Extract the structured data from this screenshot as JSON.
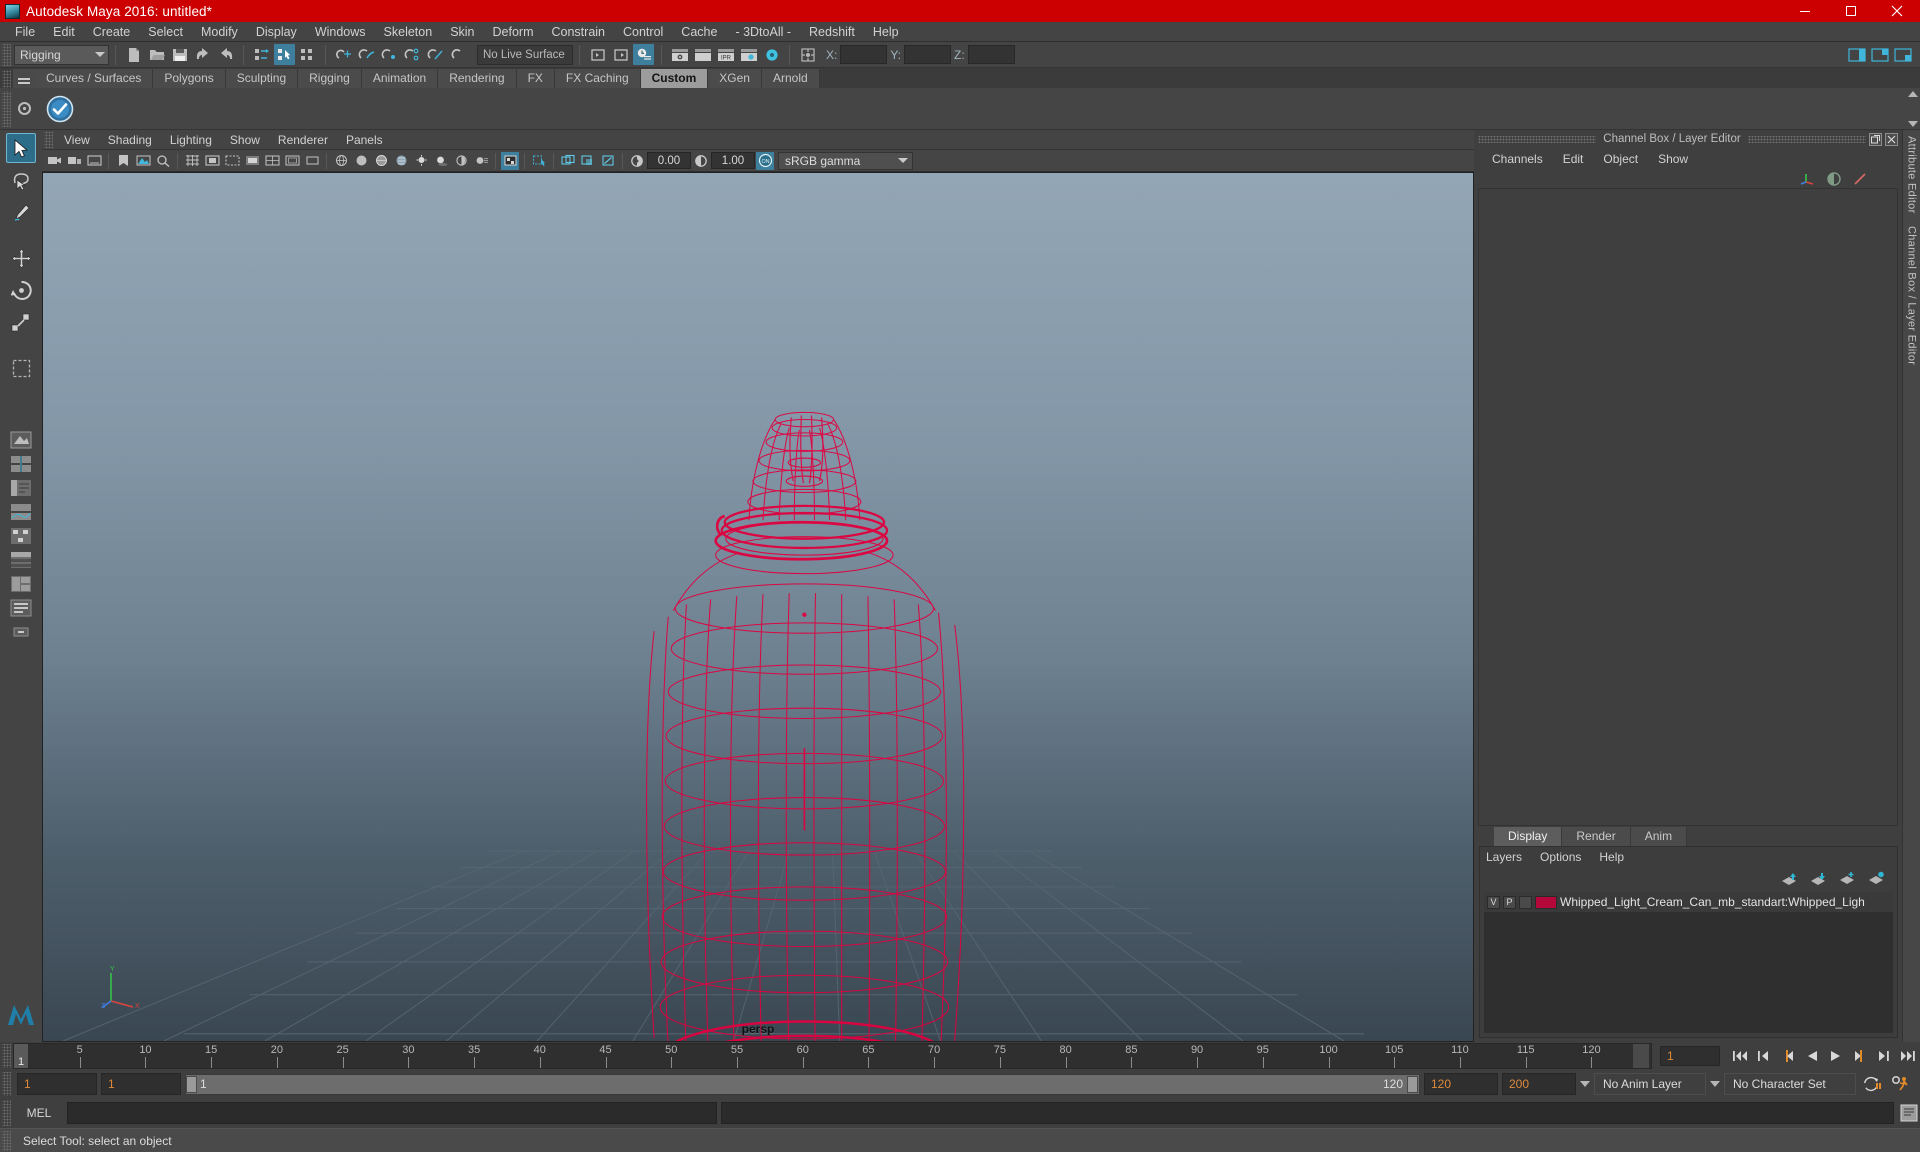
{
  "window": {
    "title": "Autodesk Maya 2016: untitled*",
    "icon": "maya-app-icon",
    "minimize": "minimize-icon",
    "maximize": "maximize-icon",
    "close": "close-icon",
    "titlebar_color": "#cc0000"
  },
  "menubar": {
    "items": [
      "File",
      "Edit",
      "Create",
      "Select",
      "Modify",
      "Display",
      "Windows",
      "Skeleton",
      "Skin",
      "Deform",
      "Constrain",
      "Control",
      "Cache",
      "- 3DtoAll -",
      "Redshift",
      "Help"
    ]
  },
  "statusline": {
    "menuset": "Rigging",
    "live_surface": "No Live Surface",
    "coords": {
      "x_label": "X:",
      "y_label": "Y:",
      "z_label": "Z:",
      "x_value": "",
      "y_value": "",
      "z_value": ""
    },
    "icons": [
      "new-scene-icon",
      "open-scene-icon",
      "save-scene-icon",
      "undo-icon",
      "redo-icon",
      "select-hierarchy-icon",
      "select-object-icon",
      "select-component-icon",
      "snap-grid-icon",
      "snap-curve-icon",
      "snap-point-icon",
      "snap-projected-icon",
      "snap-view-plane-icon",
      "make-live-icon",
      "open-editor-icon",
      "open-outliner-icon",
      "render-history-icon",
      "render-view-icon",
      "render-current-frame-icon",
      "ipr-render-icon",
      "render-settings-icon",
      "hypershade-icon",
      "show-manipulator-icon"
    ],
    "right_icons": [
      "sidebar-attribute-icon",
      "sidebar-tool-icon",
      "sidebar-channel-icon"
    ]
  },
  "shelf": {
    "tabs": [
      "Curves / Surfaces",
      "Polygons",
      "Sculpting",
      "Rigging",
      "Animation",
      "Rendering",
      "FX",
      "FX Caching",
      "Custom",
      "XGen",
      "Arnold"
    ],
    "active_tab": "Custom",
    "menu_icon": "shelf-hamburger-icon",
    "gear_icon": "shelf-gear-icon",
    "item_icon": "custom-shelf-button-icon"
  },
  "toolbox": {
    "tools": [
      {
        "name": "select-tool",
        "active": true
      },
      {
        "name": "lasso-select-tool",
        "active": false
      },
      {
        "name": "paint-select-tool",
        "active": false
      },
      {
        "name": "move-tool",
        "active": false
      },
      {
        "name": "rotate-tool",
        "active": false
      },
      {
        "name": "scale-tool",
        "active": false
      },
      {
        "name": "last-tool-used",
        "active": false
      }
    ],
    "layout_buttons": [
      "single-perspective-layout",
      "four-view-layout",
      "persp-outliner-layout",
      "persp-graph-layout",
      "persp-hypershade-layout",
      "two-pane-layout",
      "three-pane-layout",
      "outliner-layout"
    ],
    "logo": "maya-logo-icon"
  },
  "viewport": {
    "menus": [
      "View",
      "Shading",
      "Lighting",
      "Show",
      "Renderer",
      "Panels"
    ],
    "camera_label": "persp",
    "exposure_value": "0.00",
    "gamma_value": "1.00",
    "color_management": "sRGB gamma",
    "gate_toggle": "ON",
    "toolbar_icons": [
      "select-camera-icon",
      "lock-camera-icon",
      "camera-attributes-icon",
      "bookmark-icon",
      "image-plane-icon",
      "two-d-pan-zoom-icon",
      "grid-toggle-icon",
      "film-gate-icon",
      "resolution-gate-icon",
      "gate-mask-icon",
      "field-chart-icon",
      "safe-action-icon",
      "safe-title-icon",
      "wireframe-icon",
      "smooth-shade-icon",
      "shaded-wireframe-icon",
      "textured-icon",
      "lights-icon",
      "shadows-icon",
      "screen-space-ao-icon",
      "motion-blur-icon",
      "multisample-icon",
      "depth-of-field-icon",
      "isolate-select-icon",
      "xray-icon",
      "xray-joints-icon",
      "xray-active-components-icon",
      "exposure-icon",
      "gamma-icon",
      "color-management-toggle-icon"
    ],
    "object_color": "#d4003c",
    "background_top": "#93a6b6",
    "background_bottom": "#3a4752"
  },
  "channelbox": {
    "panel_title": "Channel Box / Layer Editor",
    "undock_icon": "undock-icon",
    "close_icon": "close-panel-icon",
    "menus": [
      "Channels",
      "Edit",
      "Object",
      "Show"
    ],
    "header_icons": [
      "manipulator-icon",
      "half-circle-icon",
      "speed-icon"
    ],
    "attribute_editor_label": "Attribute Editor",
    "channel_box_label": "Channel Box / Layer Editor"
  },
  "layereditor": {
    "tabs": [
      "Display",
      "Render",
      "Anim"
    ],
    "active_tab": "Display",
    "menus": [
      "Layers",
      "Options",
      "Help"
    ],
    "buttons": [
      "move-layer-up-icon",
      "move-layer-down-icon",
      "new-layer-icon",
      "new-layer-from-selected-icon"
    ],
    "layers": [
      {
        "visible": "V",
        "playback": "P",
        "third": "",
        "color": "#b4083a",
        "name": "Whipped_Light_Cream_Can_mb_standart:Whipped_Ligh"
      }
    ]
  },
  "timeslider": {
    "ticks": [
      5,
      10,
      15,
      20,
      25,
      30,
      35,
      40,
      45,
      50,
      55,
      60,
      65,
      70,
      75,
      80,
      85,
      90,
      95,
      100,
      105,
      110,
      115,
      120
    ],
    "current_frame_label": "1",
    "end_label": "120",
    "frame_input": "1",
    "playback_buttons": [
      "go-to-start-icon",
      "step-back-keyframe-icon",
      "step-back-frame-icon",
      "play-backwards-icon",
      "play-forwards-icon",
      "step-forward-frame-icon",
      "step-forward-keyframe-icon",
      "go-to-end-icon"
    ]
  },
  "rangeslider": {
    "anim_start": "1",
    "range_start": "1",
    "slider_start": "1",
    "slider_end": "120",
    "range_end": "120",
    "anim_end": "200",
    "anim_layer": "No Anim Layer",
    "character_set": "No Character Set",
    "auto_key_icon": "auto-keyframe-icon",
    "anim_prefs_icon": "animation-preferences-icon"
  },
  "commandline": {
    "language_label": "MEL",
    "input_value": "",
    "output_value": "",
    "script_editor_icon": "script-editor-icon"
  },
  "helpline": {
    "text": "Select Tool: select an object"
  }
}
